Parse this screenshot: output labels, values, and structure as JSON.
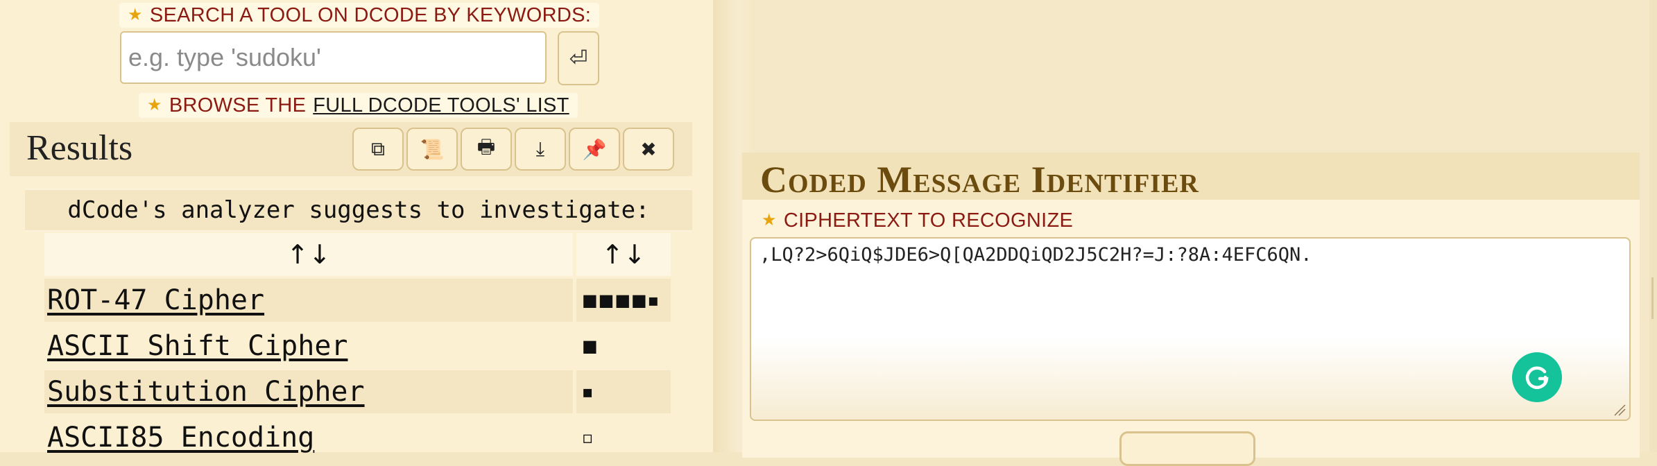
{
  "search": {
    "label": "SEARCH A TOOL ON DCODE BY KEYWORDS:",
    "placeholder": "e.g. type 'sudoku'",
    "submit_icon": "⏎"
  },
  "browse": {
    "prefix": "BROWSE THE",
    "link": "FULL DCODE TOOLS' LIST"
  },
  "results": {
    "title": "Results",
    "toolbar_icons": [
      "copy-icon",
      "scroll-icon",
      "print-icon",
      "download-icon",
      "pin-icon",
      "close-icon"
    ],
    "toolbar_glyphs": [
      "⧉",
      "📜",
      "🖶",
      "⤓",
      "📌",
      "✖"
    ],
    "suggestion": "dCode's analyzer suggests to investigate:",
    "sort_glyph": "↑↓",
    "rows": [
      {
        "name": "ROT-47 Cipher",
        "score": "■■■■▪"
      },
      {
        "name": "ASCII Shift Cipher",
        "score": "■"
      },
      {
        "name": "Substitution Cipher",
        "score": "▪"
      },
      {
        "name": "ASCII85 Encoding",
        "score": "▫"
      }
    ]
  },
  "identifier": {
    "title": "Coded Message Identifier",
    "cipher_label": "CIPHERTEXT TO RECOGNIZE",
    "ciphertext": ",LQ?2>6QiQ$JDE6>Q[QA2DDQiQD2J5C2H?=J:?8A:4EFC6QN."
  },
  "colors": {
    "accent_red": "#8b1a12",
    "title_brown": "#6b4c0e",
    "star": "#e8a40c",
    "grammarly": "#15c39a"
  }
}
